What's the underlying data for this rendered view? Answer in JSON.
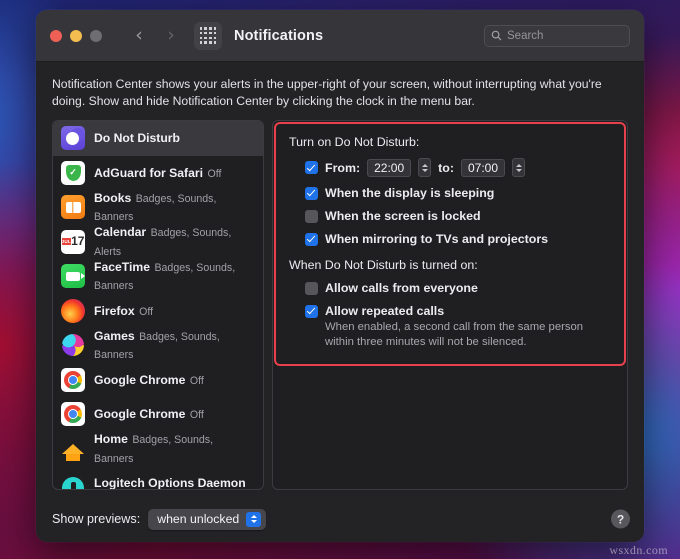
{
  "window": {
    "title": "Notifications",
    "traffic_lights": [
      "close",
      "minimize",
      "zoom"
    ],
    "back_icon": "chevron-left-icon",
    "forward_icon": "chevron-right-icon",
    "grid_icon": "app-grid-icon"
  },
  "search": {
    "placeholder": "Search",
    "value": "",
    "icon": "search-icon"
  },
  "description": "Notification Center shows your alerts in the upper-right of your screen, without interrupting what you're doing. Show and hide Notification Center by clicking the clock in the menu bar.",
  "sidebar": {
    "items": [
      {
        "name": "Do Not Disturb",
        "sub": "",
        "icon": "do-not-disturb-icon",
        "selected": true
      },
      {
        "name": "AdGuard for Safari",
        "sub": "Off",
        "icon": "adguard-icon",
        "selected": false
      },
      {
        "name": "Books",
        "sub": "Badges, Sounds, Banners",
        "icon": "books-icon",
        "selected": false
      },
      {
        "name": "Calendar",
        "sub": "Badges, Sounds, Alerts",
        "icon": "calendar-icon",
        "selected": false
      },
      {
        "name": "FaceTime",
        "sub": "Badges, Sounds, Banners",
        "icon": "facetime-icon",
        "selected": false
      },
      {
        "name": "Firefox",
        "sub": "Off",
        "icon": "firefox-icon",
        "selected": false
      },
      {
        "name": "Games",
        "sub": "Badges, Sounds, Banners",
        "icon": "games-icon",
        "selected": false
      },
      {
        "name": "Google Chrome",
        "sub": "Off",
        "icon": "chrome-icon",
        "selected": false
      },
      {
        "name": "Google Chrome",
        "sub": "Off",
        "icon": "chrome-icon",
        "selected": false
      },
      {
        "name": "Home",
        "sub": "Badges, Sounds, Banners",
        "icon": "home-icon",
        "selected": false
      },
      {
        "name": "Logitech Options Daemon",
        "sub": "",
        "icon": "logitech-icon",
        "selected": false
      }
    ],
    "calendar_icon_month": "JUL",
    "calendar_icon_day": "17"
  },
  "detail": {
    "group1_label": "Turn on Do Not Disturb:",
    "group2_label": "When Do Not Disturb is turned on:",
    "from_label": "From:",
    "from_value": "22:00",
    "to_label": "to:",
    "to_value": "07:00",
    "from_checked": true,
    "options": [
      {
        "label": "When the display is sleeping",
        "checked": true
      },
      {
        "label": "When the screen is locked",
        "checked": false
      },
      {
        "label": "When mirroring to TVs and projectors",
        "checked": true
      }
    ],
    "call_options": [
      {
        "label": "Allow calls from everyone",
        "checked": false
      },
      {
        "label": "Allow repeated calls",
        "checked": true
      }
    ],
    "help_text": "When enabled, a second call from the same person within three minutes will not be silenced.",
    "highlight_color": "#e8414d"
  },
  "footer": {
    "previews_label": "Show previews:",
    "previews_value": "when unlocked",
    "help_button_label": "?"
  },
  "watermark": "wsxdn.com",
  "colors": {
    "accent": "#1f72e8",
    "titlebar": "#363539",
    "window_bg": "#232225",
    "pane_bg": "#1f1e21",
    "selection": "#3a393e"
  }
}
